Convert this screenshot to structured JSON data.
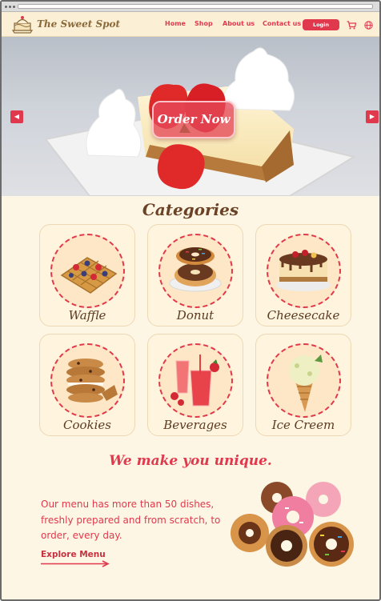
{
  "brand": {
    "name": "The Sweet Spot"
  },
  "nav": {
    "links": [
      "Home",
      "Shop",
      "About us",
      "Contact us"
    ],
    "login_label": "Login",
    "cart_icon": "cart-icon",
    "language_icon": "globe-icon"
  },
  "hero": {
    "cta_label": "Order Now",
    "prev_icon": "arrow-left-icon",
    "next_icon": "arrow-right-icon"
  },
  "categories": {
    "title": "Categories",
    "items": [
      {
        "label": "Waffle"
      },
      {
        "label": "Donut"
      },
      {
        "label": "Cheesecake"
      },
      {
        "label": "Cookies"
      },
      {
        "label": "Beverages"
      },
      {
        "label": "Ice Creem"
      }
    ]
  },
  "promo": {
    "tagline": "We make you unique.",
    "description": "Our menu has more than 50 dishes, freshly prepared and from scratch, to order, every day.",
    "link_label": "Explore Menu"
  },
  "colors": {
    "accent": "#e0394d",
    "background": "#fdf6e4",
    "brown": "#6b4226"
  }
}
